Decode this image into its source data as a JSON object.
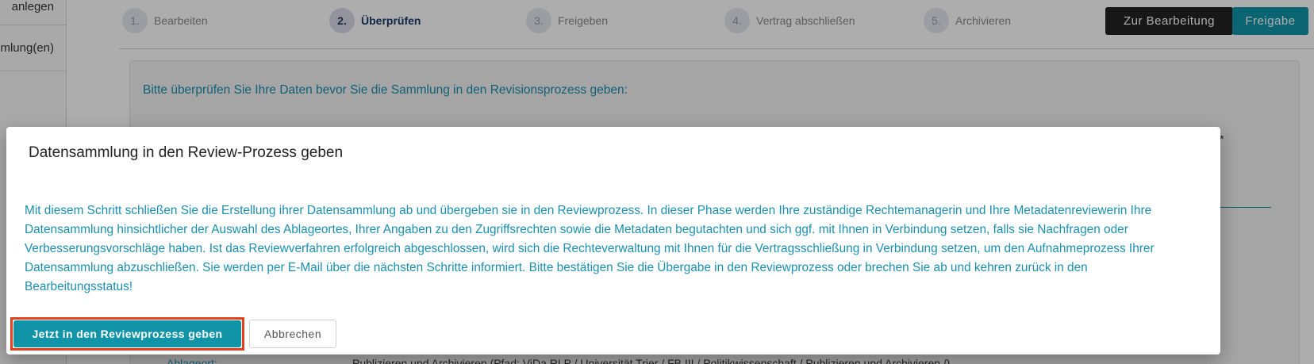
{
  "sidebar": {
    "items": [
      {
        "label": "anlegen"
      },
      {
        "label": "mlung(en)"
      }
    ]
  },
  "stepper": {
    "steps": [
      {
        "number": "1.",
        "label": "Bearbeiten",
        "active": false
      },
      {
        "number": "2.",
        "label": "Überprüfen",
        "active": true
      },
      {
        "number": "3.",
        "label": "Freigeben",
        "active": false
      },
      {
        "number": "4.",
        "label": "Vertrag abschließen",
        "active": false
      },
      {
        "number": "5.",
        "label": "Archivieren",
        "active": false
      }
    ]
  },
  "header_buttons": {
    "edit_label": "Zur Bearbeitung",
    "release_label": "Freigabe"
  },
  "card": {
    "intro": "Bitte überprüfen Sie Ihre Daten bevor Sie die Sammlung in den Revisionsprozess geben:",
    "asterisk": "*",
    "storage_label": "Ablageort:",
    "storage_value": "Publizieren und Archivieren (Pfad: ViDa RLP / Universität Trier / FB III / Politikwissenschaft / Publizieren und Archivieren /)"
  },
  "dialog": {
    "title": "Datensammlung in den Review-Prozess geben",
    "body": "Mit diesem Schritt schließen Sie die Erstellung ihrer Datensammlung ab und übergeben sie in den Reviewprozess. In dieser Phase werden Ihre zuständige Rechtemanagerin und Ihre Metadatenreviewerin Ihre Datensammlung hinsichtlicher der Auswahl des Ablageortes, Ihrer Angaben zu den Zugriffsrechten sowie die Metadaten begutachten und sich ggf. mit Ihnen in Verbindung setzen, falls sie Nachfragen oder Verbesserungsvorschläge haben. Ist das Reviewverfahren erfolgreich abgeschlossen, wird sich die Rechteverwaltung mit Ihnen für die Vertragsschließung in Verbindung setzen, um den Aufnahmeprozess Ihrer Datensammlung abzuschließen. Sie werden per E-Mail über die nächsten Schritte informiert. Bitte bestätigen Sie die Übergabe in den Reviewprozess oder brechen Sie ab und kehren zurück in den Bearbeitungsstatus!",
    "confirm_label": "Jetzt in den Reviewprozess geben",
    "cancel_label": "Abbrechen"
  },
  "colors": {
    "accent": "#1194a8",
    "text_link": "#1a8fb0",
    "highlight": "#e2401c",
    "dark_button": "#222222"
  }
}
